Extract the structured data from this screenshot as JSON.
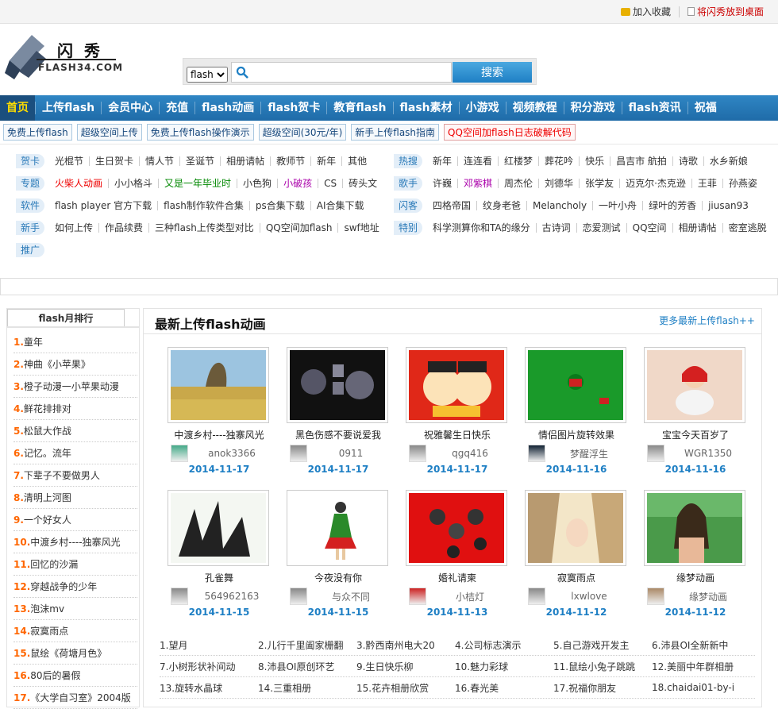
{
  "topbar": {
    "favorite": "加入收藏",
    "desktop": "将闪秀放到桌面"
  },
  "logo": {
    "cn": "闪秀",
    "en": "FLASH34.COM"
  },
  "search": {
    "selected": "flash",
    "options": [
      "flash"
    ],
    "value": "",
    "button": "搜索"
  },
  "nav": [
    "首页",
    "上传flash",
    "会员中心",
    "充值",
    "flash动画",
    "flash贺卡",
    "教育flash",
    "flash素材",
    "小游戏",
    "视频教程",
    "积分游戏",
    "flash资讯",
    "祝福"
  ],
  "subnav": [
    "免费上传flash",
    "超级空间上传",
    "免费上传flash操作演示",
    "超级空间(30元/年)",
    "新手上传flash指南",
    "QQ空间加flash日志破解代码"
  ],
  "tags_left": [
    {
      "label": "贺卡",
      "items": [
        "光棍节",
        "生日贺卡",
        "情人节",
        "圣诞节",
        "相册请帖",
        "教师节",
        "新年",
        "其他"
      ]
    },
    {
      "label": "专题",
      "items": [
        "火柴人动画",
        "小小格斗",
        "又是一年毕业时",
        "小色狗",
        "小破孩",
        "CS",
        "砖头文"
      ]
    },
    {
      "label": "软件",
      "items": [
        "flash player 官方下载",
        "flash制作软件合集",
        "ps合集下载",
        "AI合集下载"
      ]
    },
    {
      "label": "新手",
      "items": [
        "如何上传",
        "作品续费",
        "三种flash上传类型对比",
        "QQ空间加flash",
        "swf地址"
      ]
    },
    {
      "label": "推广",
      "items": []
    }
  ],
  "tags_right": [
    {
      "label": "热搜",
      "items": [
        "新年",
        "连连看",
        "红楼梦",
        "葬花吟",
        "快乐",
        "昌吉市 航拍",
        "诗歌",
        "水乡新娘"
      ]
    },
    {
      "label": "歌手",
      "items": [
        "许巍",
        "邓紫棋",
        "周杰伦",
        "刘德华",
        "张学友",
        "迈克尔·杰克逊",
        "王菲",
        "孙燕姿"
      ]
    },
    {
      "label": "闪客",
      "items": [
        "四格帝国",
        "纹身老爸",
        "Melancholy",
        "一叶小舟",
        "绿叶的芳香",
        "jiusan93"
      ]
    },
    {
      "label": "特别",
      "items": [
        "科学测算你和TA的缘分",
        "古诗词",
        "恋爱测试",
        "QQ空间",
        "相册请帖",
        "密室逃脱"
      ]
    }
  ],
  "sidebar": {
    "title": "flash月排行",
    "items": [
      {
        "n": "1.",
        "t": "童年"
      },
      {
        "n": "2.",
        "t": "神曲《小苹果》"
      },
      {
        "n": "3.",
        "t": "橙子动漫一小苹果动漫"
      },
      {
        "n": "4.",
        "t": "鲜花排排对"
      },
      {
        "n": "5.",
        "t": "松鼠大作战"
      },
      {
        "n": "6.",
        "t": "记忆。流年"
      },
      {
        "n": "7.",
        "t": "下辈子不要做男人"
      },
      {
        "n": "8.",
        "t": "清明上河图"
      },
      {
        "n": "9.",
        "t": "一个好女人"
      },
      {
        "n": "10.",
        "t": "中渡乡村----独寨风光"
      },
      {
        "n": "11.",
        "t": "回忆的沙漏"
      },
      {
        "n": "12.",
        "t": "穿越战争的少年"
      },
      {
        "n": "13.",
        "t": "泡沫mv"
      },
      {
        "n": "14.",
        "t": "寂寞雨点"
      },
      {
        "n": "15.",
        "t": "鼠绘《荷塘月色》"
      },
      {
        "n": "16.",
        "t": "80后的暑假"
      },
      {
        "n": "17.",
        "t": "《大学自习室》2004版"
      }
    ]
  },
  "main": {
    "title": "最新上传flash动画",
    "more": "更多最新上传flash++"
  },
  "cards": [
    {
      "title": "中渡乡村----独寨风光",
      "user": "anok3366",
      "date": "2014-11-17"
    },
    {
      "title": "黑色伤感不要说爱我",
      "user": "0911",
      "date": "2014-11-17"
    },
    {
      "title": "祝雅馨生日快乐",
      "user": "qgq416",
      "date": "2014-11-17"
    },
    {
      "title": "情侣图片旋转效果",
      "user": "梦醒浮生",
      "date": "2014-11-16"
    },
    {
      "title": "宝宝今天百岁了",
      "user": "WGR1350",
      "date": "2014-11-16"
    },
    {
      "title": "孔雀舞",
      "user": "564962163",
      "date": "2014-11-15"
    },
    {
      "title": "今夜没有你",
      "user": "与众不同",
      "date": "2014-11-15"
    },
    {
      "title": "婚礼请柬",
      "user": "小桔灯",
      "date": "2014-11-13"
    },
    {
      "title": "寂寞雨点",
      "user": "lxwlove",
      "date": "2014-11-12"
    },
    {
      "title": "缘梦动画",
      "user": "缘梦动画",
      "date": "2014-11-12"
    }
  ],
  "list": [
    [
      "1.望月",
      "2.儿行千里阖家栅翻",
      "3.黔西南州电大20",
      "4.公司标志演示",
      "5.自己游戏开发主",
      "6.沛县OI全新新中"
    ],
    [
      "7.小树形状补间动",
      "8.沛县OI原创环艺",
      "9.生日快乐柳",
      "10.魅力彩球",
      "11.鼠绘小兔子跳跳",
      "12.美丽中年群相册"
    ],
    [
      "13.旋转水晶球",
      "14.三重相册",
      "15.花卉相册欣赏",
      "16.春光美",
      "17.祝福你朋友",
      "18.chaidai01-by-i"
    ]
  ],
  "colors": {
    "nav_blue": "#1f6ba8",
    "accent_blue": "#1e7fc4",
    "rank_orange": "#ff6600",
    "red": "#ee0000"
  }
}
